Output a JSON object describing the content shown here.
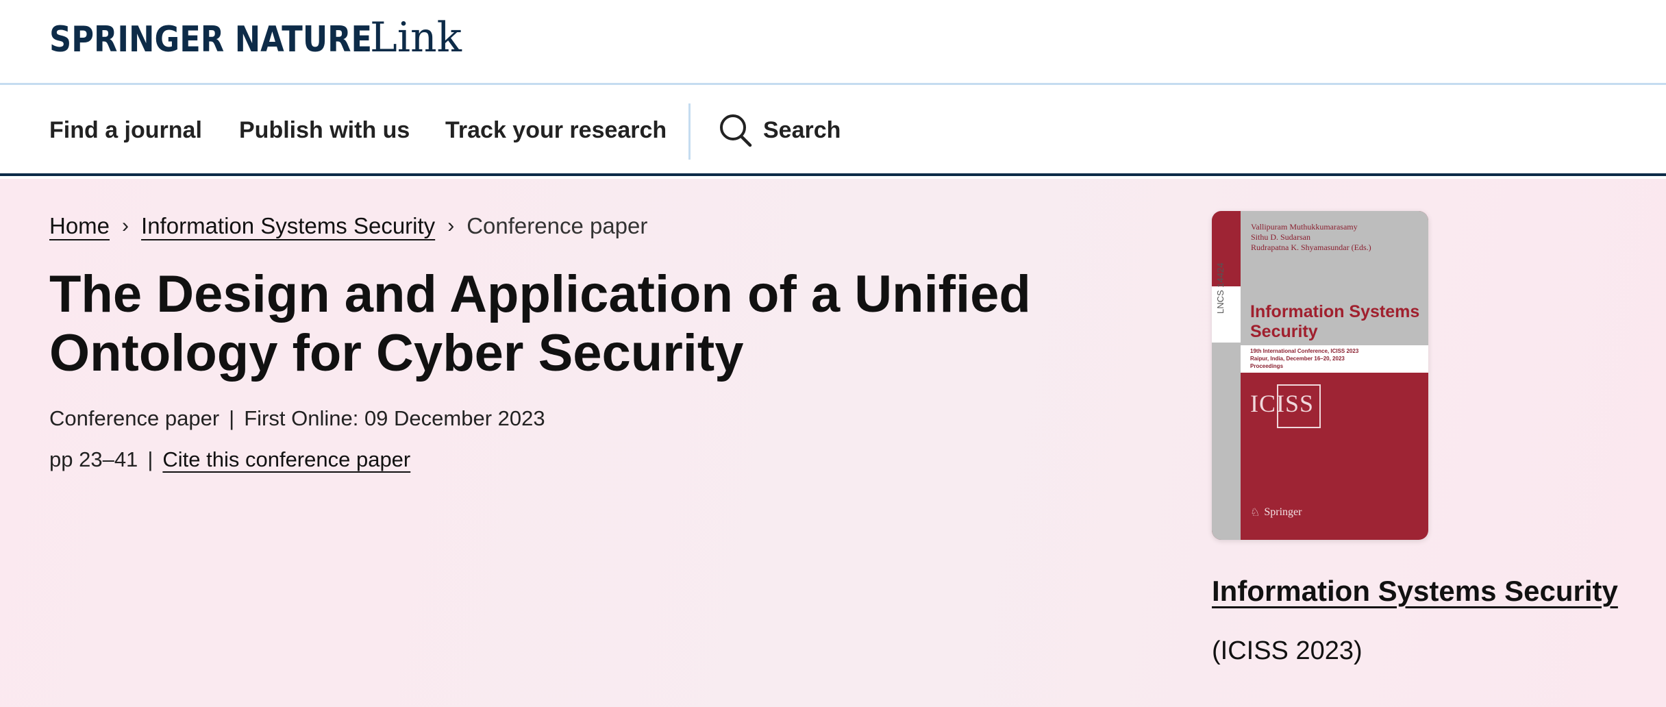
{
  "brand": {
    "name": "SPRINGER NATURE",
    "product": "Link"
  },
  "nav": {
    "items": [
      {
        "label": "Find a journal"
      },
      {
        "label": "Publish with us"
      },
      {
        "label": "Track your research"
      }
    ],
    "search_label": "Search"
  },
  "breadcrumb": {
    "home": "Home",
    "separator": "›",
    "book": "Information Systems Security",
    "current": "Conference paper"
  },
  "article": {
    "title": "The Design and Application of a Unified Ontology for Cyber Security",
    "type": "Conference paper",
    "pipe": "|",
    "first_online": "First Online: 09 December 2023",
    "pages": "pp 23–41",
    "cite_label": "Cite this conference paper"
  },
  "book": {
    "title": "Information Systems Security",
    "subtitle": "(ICISS 2023)",
    "cover": {
      "editors": [
        "Vallipuram Muthukkumarasamy",
        "Sithu D. Sudarsan",
        "Rudrapatna K. Shyamasundar (Eds.)"
      ],
      "series": "LNCS 14424",
      "title_line1": "Information Systems",
      "title_line2": "Security",
      "conference_lines": [
        "19th International Conference, ICISS 2023",
        "Raipur, India, December 16–20, 2023",
        "Proceedings"
      ],
      "logo_text": "ICISS",
      "publisher": "Springer",
      "colors": {
        "red": "#9e2434",
        "gray": "#bdbdbd"
      }
    }
  },
  "colors": {
    "brand_navy": "#0d2b48",
    "hero_bg": "#fbe9f0",
    "divider_blue": "#c5dcf0"
  }
}
